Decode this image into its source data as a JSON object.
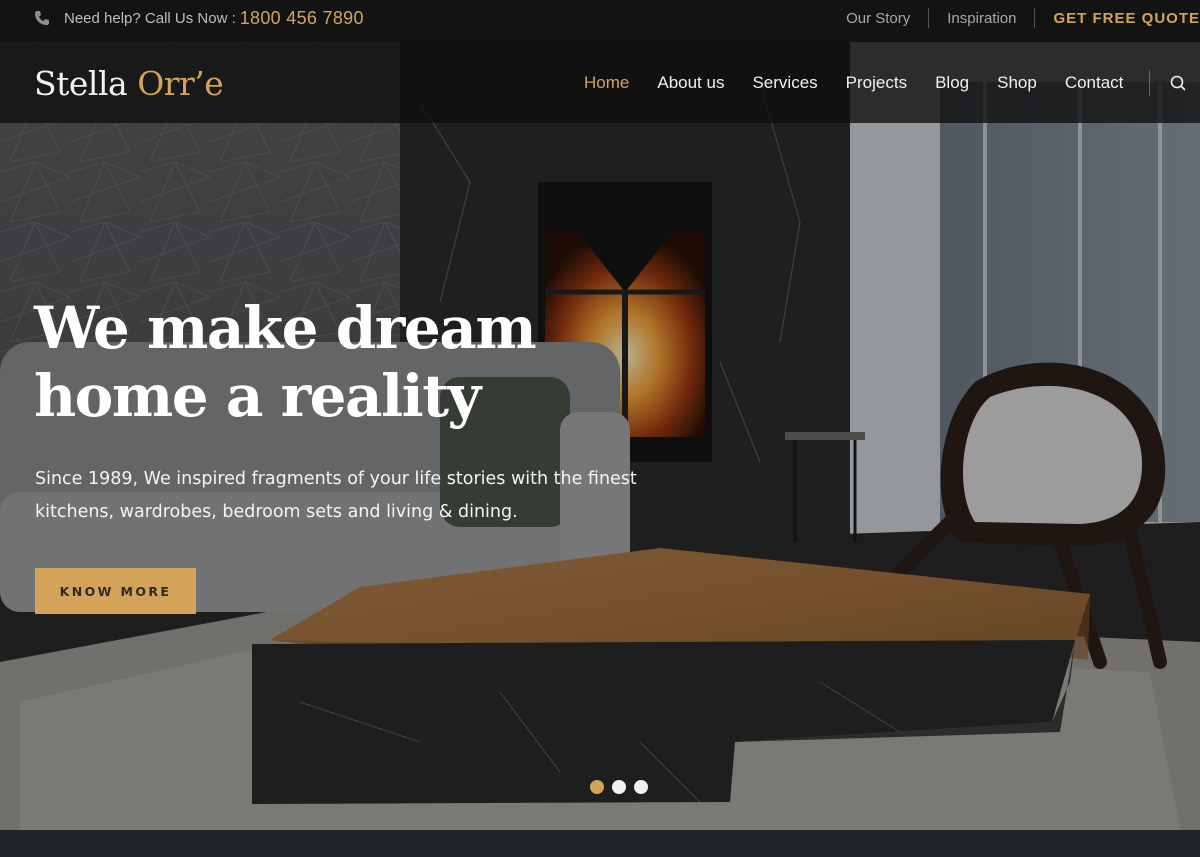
{
  "topbar": {
    "help_text": "Need help? Call Us Now :",
    "phone": "1800 456 7890",
    "links": [
      "Our Story",
      "Inspiration",
      "GET FREE QUOTE"
    ]
  },
  "nav": {
    "logo_main": "Stella",
    "logo_accent": "Orr’e",
    "items": [
      "Home",
      "About us",
      "Services",
      "Projects",
      "Blog",
      "Shop",
      "Contact"
    ],
    "active": "Home"
  },
  "hero": {
    "headline_line1": "We make dream",
    "headline_line2": "home a reality",
    "subtext": "Since 1989, We inspired fragments of your life stories with the finest kitchens, wardrobes, bedroom sets and living & dining.",
    "cta": "KNOW MORE",
    "slides": 3,
    "active_slide": 1
  },
  "colors": {
    "accent": "#d4a35a",
    "topbar_bg": "#131313",
    "footer_bg": "#1f2428"
  }
}
